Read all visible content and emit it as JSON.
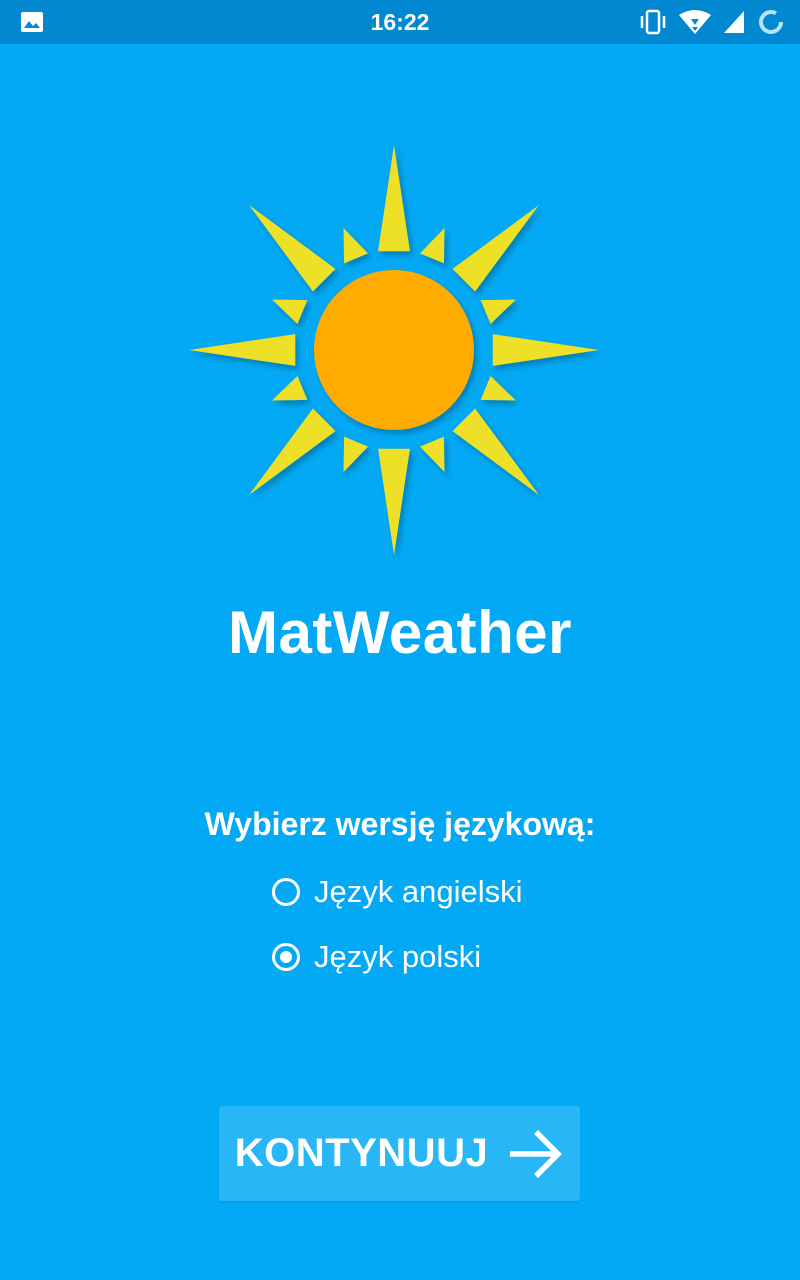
{
  "status_bar": {
    "time": "16:22",
    "icons": [
      "gallery-icon",
      "vibrate-icon",
      "wifi-icon",
      "signal-icon",
      "sync-icon"
    ]
  },
  "app": {
    "title": "MatWeather",
    "logo_icon": "sun-icon"
  },
  "language_select": {
    "prompt": "Wybierz wersję językową:",
    "options": [
      {
        "label": "Język angielski",
        "selected": false
      },
      {
        "label": "Język polski",
        "selected": true
      }
    ]
  },
  "continue_button": {
    "label": "KONTYNUUJ",
    "icon": "arrow-right-icon"
  },
  "colors": {
    "background": "#03a9f4",
    "status_bar": "#0288d1",
    "sun_core": "#ffab00",
    "sun_rays": "#ede027",
    "button": "#29b6f6"
  }
}
